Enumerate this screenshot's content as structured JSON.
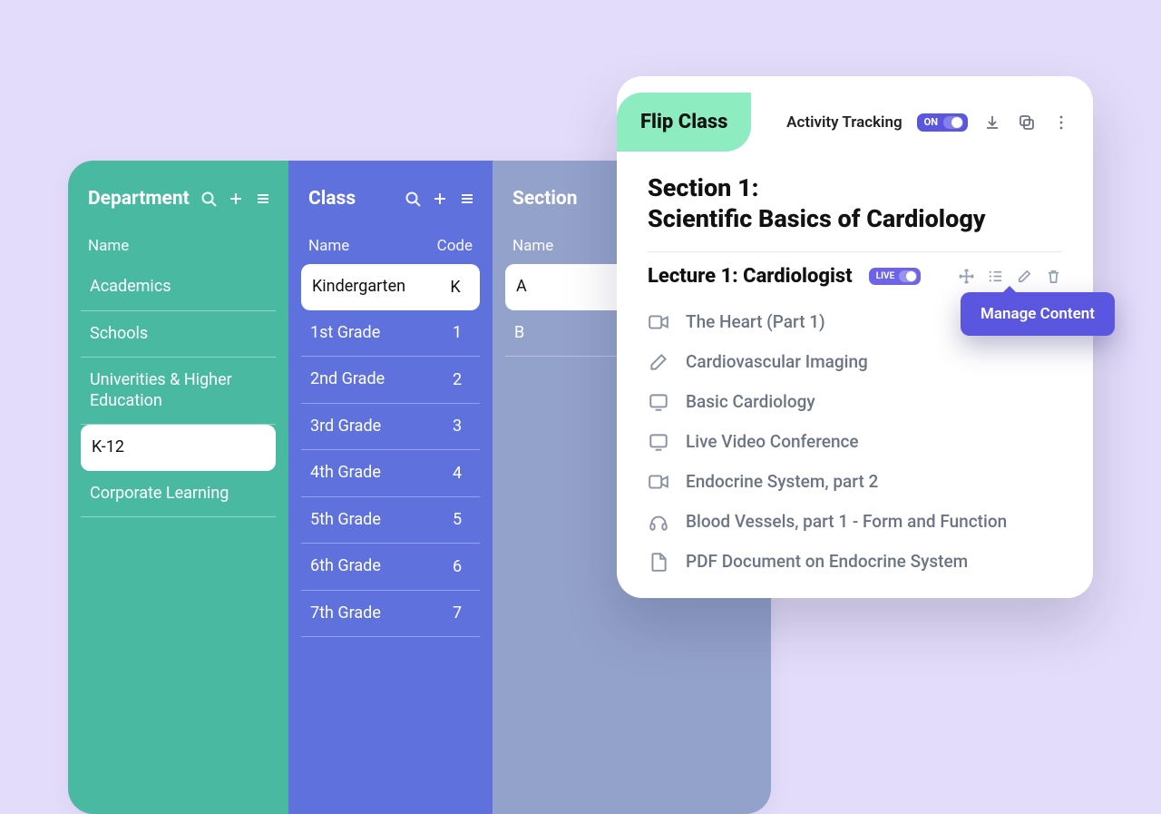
{
  "columns": {
    "department": {
      "title": "Department",
      "nameHeader": "Name",
      "items": [
        {
          "label": "Academics"
        },
        {
          "label": "Schools"
        },
        {
          "label": "Univerities & Higher Education"
        },
        {
          "label": "K-12",
          "selected": true
        },
        {
          "label": "Corporate Learning"
        }
      ]
    },
    "klass": {
      "title": "Class",
      "nameHeader": "Name",
      "codeHeader": "Code",
      "items": [
        {
          "label": "Kindergarten",
          "code": "K",
          "selected": true
        },
        {
          "label": "1st Grade",
          "code": "1"
        },
        {
          "label": "2nd Grade",
          "code": "2"
        },
        {
          "label": "3rd Grade",
          "code": "3"
        },
        {
          "label": "4th Grade",
          "code": "4"
        },
        {
          "label": "5th Grade",
          "code": "5"
        },
        {
          "label": "6th Grade",
          "code": "6"
        },
        {
          "label": "7th Grade",
          "code": "7"
        }
      ]
    },
    "section": {
      "title": "Section",
      "nameHeader": "Name",
      "items": [
        {
          "label": "A",
          "selected": true
        },
        {
          "label": "B"
        }
      ]
    }
  },
  "flip": {
    "tab": "Flip Class",
    "trackingLabel": "Activity Tracking",
    "trackingOn": "ON",
    "sectionTitleLine1": "Section 1:",
    "sectionTitleLine2": "Scientific Basics of Cardiology",
    "lectureTitle": "Lecture 1: Cardiologist",
    "liveLabel": "LIVE",
    "tooltip": "Manage Content",
    "contents": [
      {
        "type": "video",
        "label": "The Heart (Part 1)"
      },
      {
        "type": "edit",
        "label": "Cardiovascular Imaging"
      },
      {
        "type": "screen",
        "label": "Basic Cardiology"
      },
      {
        "type": "screen",
        "label": "Live Video Conference"
      },
      {
        "type": "video",
        "label": "Endocrine System, part 2"
      },
      {
        "type": "audio",
        "label": "Blood Vessels, part 1 - Form and Function"
      },
      {
        "type": "file",
        "label": "PDF Document on Endocrine System"
      }
    ]
  }
}
